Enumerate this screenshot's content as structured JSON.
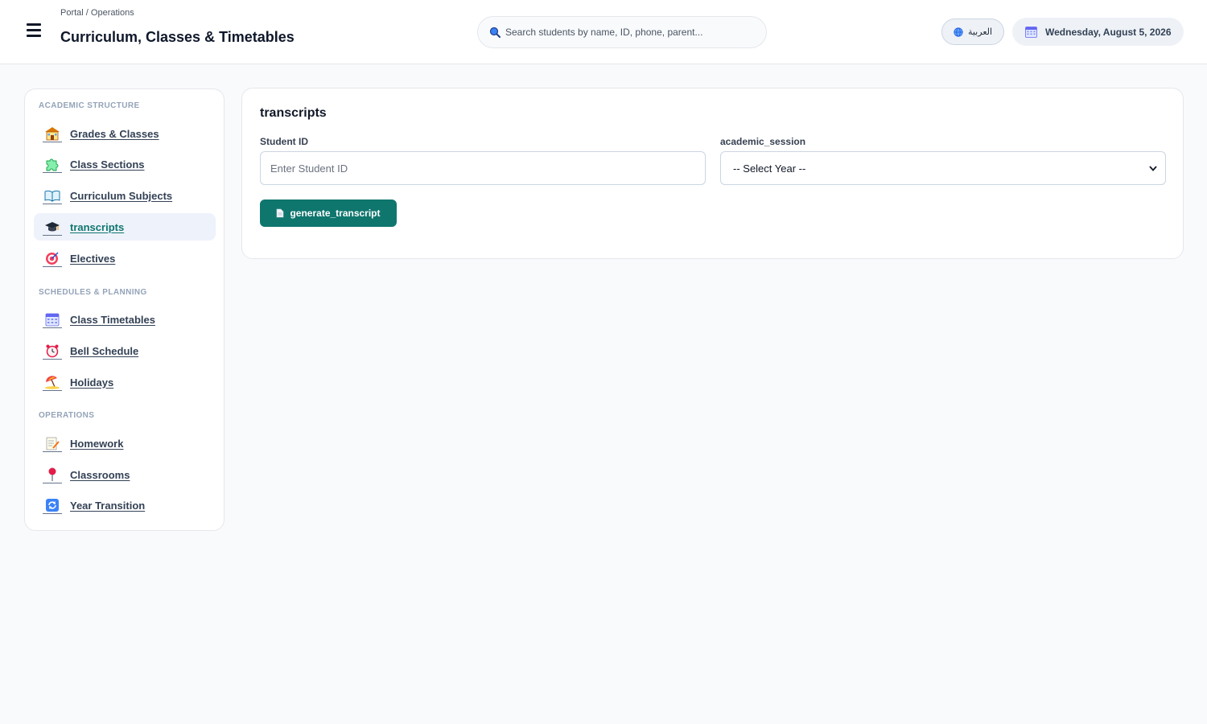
{
  "header": {
    "breadcrumb": "Portal / Operations",
    "title": "Curriculum, Classes & Timetables",
    "search_placeholder": "Search students by name, ID, phone, parent...",
    "language_label": "العربية",
    "date": "Wednesday, August 5, 2026"
  },
  "sidebar": {
    "sections": [
      {
        "title": "ACADEMIC STRUCTURE"
      },
      {
        "title": "SCHEDULES & PLANNING"
      },
      {
        "title": "OPERATIONS"
      }
    ],
    "items": [
      {
        "label": "Grades & Classes",
        "icon": "school-icon"
      },
      {
        "label": "Class Sections",
        "icon": "puzzle-icon"
      },
      {
        "label": "Curriculum Subjects",
        "icon": "book-icon"
      },
      {
        "label": "transcripts",
        "icon": "graduation-cap-icon",
        "active": true
      },
      {
        "label": "Electives",
        "icon": "target-icon"
      },
      {
        "label": "Class Timetables",
        "icon": "calendar-icon"
      },
      {
        "label": "Bell Schedule",
        "icon": "alarm-clock-icon"
      },
      {
        "label": "Holidays",
        "icon": "beach-umbrella-icon"
      },
      {
        "label": "Homework",
        "icon": "memo-icon"
      },
      {
        "label": "Classrooms",
        "icon": "pin-icon"
      },
      {
        "label": "Year Transition",
        "icon": "refresh-icon"
      }
    ]
  },
  "main": {
    "title": "transcripts",
    "student_id_label": "Student ID",
    "student_id_placeholder": "Enter Student ID",
    "session_label": "academic_session",
    "session_selected": "-- Select Year --",
    "generate_label": "generate_transcript"
  },
  "colors": {
    "accent": "#0f766e",
    "active_bg": "#eef2fb",
    "background": "#f8fafc"
  }
}
